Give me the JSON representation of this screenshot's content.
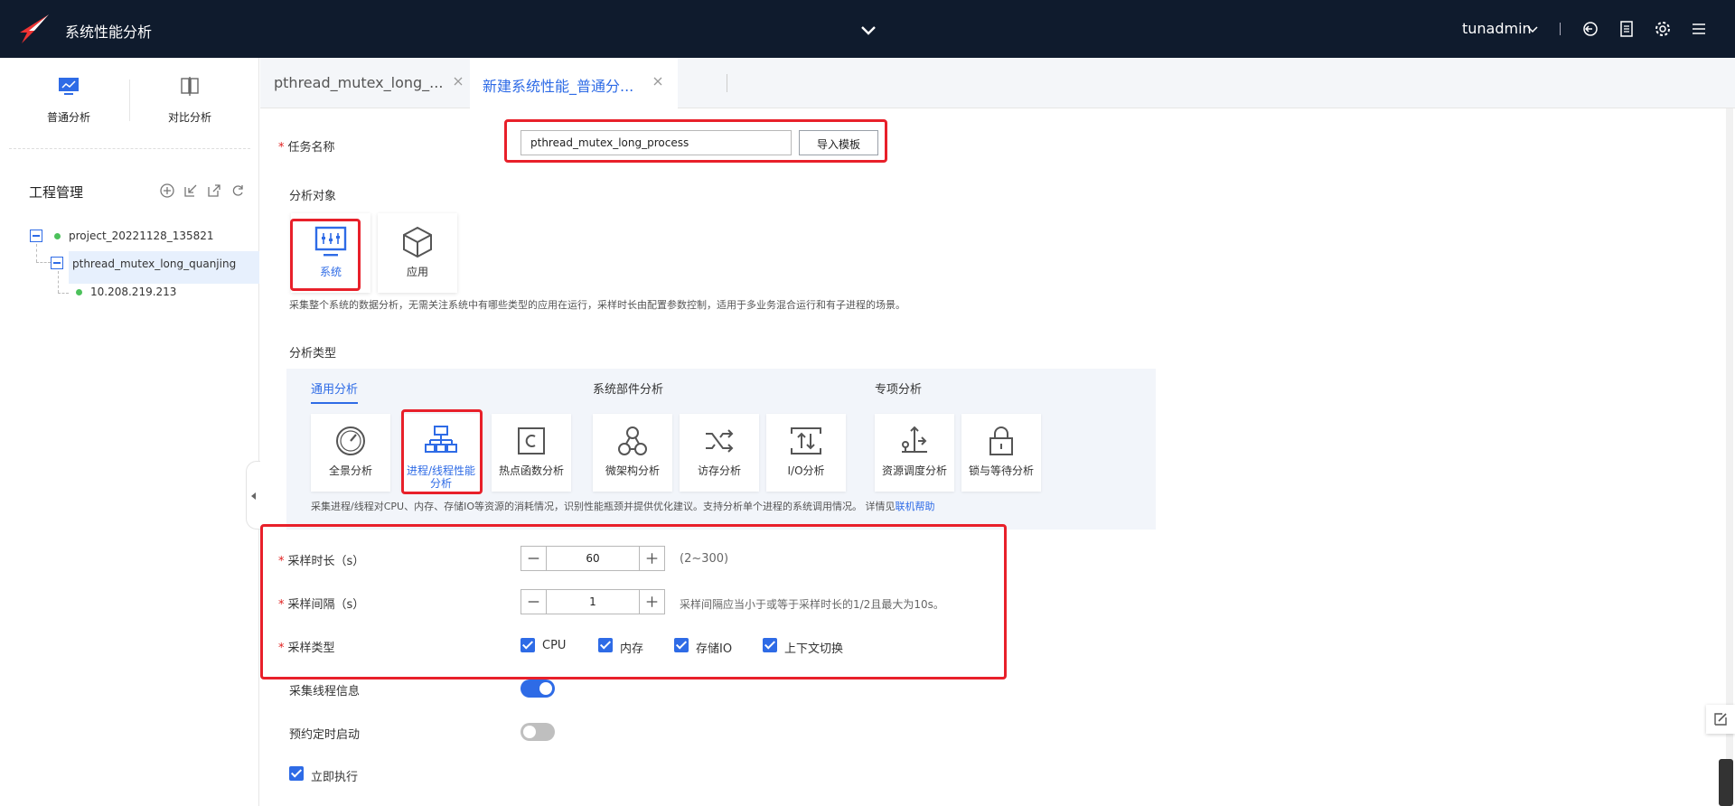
{
  "app": {
    "title": "系统性能分析",
    "user": "tunadmin"
  },
  "left": {
    "modes": [
      {
        "label": "普通分析",
        "icon": "monitor-chart-icon"
      },
      {
        "label": "对比分析",
        "icon": "compare-icon"
      }
    ],
    "project_title": "工程管理",
    "tree": {
      "project": "project_20221128_135821",
      "task": "pthread_mutex_long_quanjing",
      "node": "10.208.219.213"
    }
  },
  "tabs": [
    {
      "label": "pthread_mutex_long_..."
    },
    {
      "label": "新建系统性能_普通分..."
    }
  ],
  "form": {
    "task_name_label": "任务名称",
    "task_name_value": "pthread_mutex_long_process",
    "import_button": "导入模板",
    "target_title": "分析对象",
    "targets": [
      {
        "label": "系统"
      },
      {
        "label": "应用"
      }
    ],
    "target_desc": "采集整个系统的数据分析，无需关注系统中有哪些类型的应用在运行，采样时长由配置参数控制，适用于多业务混合运行和有子进程的场景。",
    "type_title": "分析类型",
    "groups": [
      "通用分析",
      "系统部件分析",
      "专项分析"
    ],
    "types": [
      {
        "label": "全景分析"
      },
      {
        "label": "进程/线程性能分析"
      },
      {
        "label": "热点函数分析"
      },
      {
        "label": "微架构分析"
      },
      {
        "label": "访存分析"
      },
      {
        "label": "I/O分析"
      },
      {
        "label": "资源调度分析"
      },
      {
        "label": "锁与等待分析"
      }
    ],
    "type_desc": "采集进程/线程对CPU、内存、存储IO等资源的消耗情况，识别性能瓶颈并提供优化建议。支持分析单个进程的系统调用情况。 详情见",
    "type_desc_link": "联机帮助",
    "duration_label": "采样时长（s）",
    "duration_value": "60",
    "duration_hint": "(2~300)",
    "interval_label": "采样间隔（s）",
    "interval_value": "1",
    "interval_hint": "采样间隔应当小于或等于采样时长的1/2且最大为10s。",
    "sample_type_label": "采样类型",
    "sample_types": [
      "CPU",
      "内存",
      "存储IO",
      "上下文切换"
    ],
    "collect_thread_label": "采集线程信息",
    "collect_thread_on": true,
    "schedule_label": "预约定时启动",
    "schedule_on": false,
    "run_now_label": "立即执行"
  },
  "colors": {
    "accent": "#2e6be6",
    "topbar": "#0f1b2d",
    "highlight": "#e8202a"
  }
}
